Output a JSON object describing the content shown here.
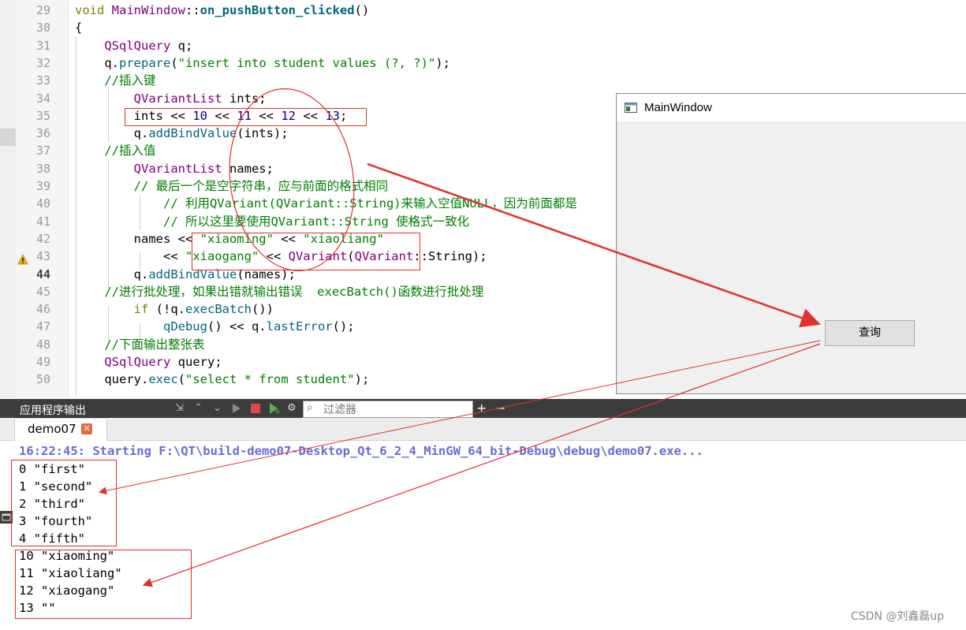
{
  "editor": {
    "line_numbers": [
      "29",
      "30",
      "31",
      "32",
      "33",
      "34",
      "35",
      "36",
      "37",
      "38",
      "39",
      "40",
      "41",
      "42",
      "43",
      "44",
      "45",
      "46",
      "47",
      "48",
      "49",
      "50"
    ],
    "current_line": "44",
    "lines": [
      [
        {
          "t": "void ",
          "c": "kw"
        },
        {
          "t": "MainWindow",
          "c": "typ"
        },
        {
          "t": "::",
          "c": ""
        },
        {
          "t": "on_pushButton_clicked",
          "c": "fn-b"
        },
        {
          "t": "()",
          "c": ""
        }
      ],
      [
        {
          "t": "{",
          "c": ""
        }
      ],
      [
        {
          "t": "    QSqlQuery ",
          "c": "typ"
        },
        {
          "t": "q;",
          "c": ""
        }
      ],
      [
        {
          "t": "    q.",
          "c": ""
        },
        {
          "t": "prepare",
          "c": "fn"
        },
        {
          "t": "(",
          "c": ""
        },
        {
          "t": "\"insert into student values (?, ?)\"",
          "c": "str"
        },
        {
          "t": ");",
          "c": ""
        }
      ],
      [
        {
          "t": "    //插入键",
          "c": "cm"
        }
      ],
      [
        {
          "t": "        QVariantList ",
          "c": "typ"
        },
        {
          "t": "ints;",
          "c": ""
        }
      ],
      [
        {
          "t": "        ints << ",
          "c": ""
        },
        {
          "t": "10",
          "c": "num"
        },
        {
          "t": " << ",
          "c": ""
        },
        {
          "t": "11",
          "c": "num"
        },
        {
          "t": " << ",
          "c": ""
        },
        {
          "t": "12",
          "c": "num"
        },
        {
          "t": " << ",
          "c": ""
        },
        {
          "t": "13",
          "c": "num"
        },
        {
          "t": ";",
          "c": ""
        }
      ],
      [
        {
          "t": "        q.",
          "c": ""
        },
        {
          "t": "addBindValue",
          "c": "fn"
        },
        {
          "t": "(ints);",
          "c": ""
        }
      ],
      [
        {
          "t": "    //插入值",
          "c": "cm"
        }
      ],
      [
        {
          "t": "        QVariantList ",
          "c": "typ"
        },
        {
          "t": "names;",
          "c": ""
        }
      ],
      [
        {
          "t": "        // 最后一个是空字符串，应与前面的格式相同",
          "c": "cm"
        }
      ],
      [
        {
          "t": "            // 利用QVariant(QVariant::String)来输入空值NULL，因为前面都是",
          "c": "cm"
        }
      ],
      [
        {
          "t": "            // 所以这里要使用QVariant::String 使格式一致化",
          "c": "cm"
        }
      ],
      [
        {
          "t": "        names << ",
          "c": ""
        },
        {
          "t": "\"xiaoming\"",
          "c": "str"
        },
        {
          "t": " << ",
          "c": ""
        },
        {
          "t": "\"xiaoliang\"",
          "c": "str"
        }
      ],
      [
        {
          "t": "            << ",
          "c": ""
        },
        {
          "t": "\"xiaogang\"",
          "c": "str"
        },
        {
          "t": " << ",
          "c": ""
        },
        {
          "t": "QVariant",
          "c": "typ"
        },
        {
          "t": "(",
          "c": ""
        },
        {
          "t": "QVariant",
          "c": "typ"
        },
        {
          "t": "::String);",
          "c": ""
        }
      ],
      [
        {
          "t": "        q.",
          "c": ""
        },
        {
          "t": "addBindValue",
          "c": "fn"
        },
        {
          "t": "(names);",
          "c": ""
        }
      ],
      [
        {
          "t": "    //进行批处理，如果出错就输出错误  execBatch()函数进行批处理",
          "c": "cm"
        }
      ],
      [
        {
          "t": "        ",
          "c": ""
        },
        {
          "t": "if",
          "c": "kw"
        },
        {
          "t": " (!q.",
          "c": ""
        },
        {
          "t": "execBatch",
          "c": "fn"
        },
        {
          "t": "())",
          "c": ""
        }
      ],
      [
        {
          "t": "            ",
          "c": ""
        },
        {
          "t": "qDebug",
          "c": "fn"
        },
        {
          "t": "() << q.",
          "c": ""
        },
        {
          "t": "lastError",
          "c": "fn"
        },
        {
          "t": "();",
          "c": ""
        }
      ],
      [
        {
          "t": "    //下面输出整张表",
          "c": "cm"
        }
      ],
      [
        {
          "t": "    QSqlQuery ",
          "c": "typ"
        },
        {
          "t": "query;",
          "c": ""
        }
      ],
      [
        {
          "t": "    query.",
          "c": ""
        },
        {
          "t": "exec",
          "c": "fn"
        },
        {
          "t": "(",
          "c": ""
        },
        {
          "t": "\"select * from student\"",
          "c": "str"
        },
        {
          "t": ");",
          "c": ""
        }
      ]
    ]
  },
  "mainwindow": {
    "title": "MainWindow",
    "query_button": "查询"
  },
  "output": {
    "pane_title": "应用程序输出",
    "filter_placeholder": "过滤器",
    "tab_label": "demo07",
    "start_line": "16:22:45: Starting F:\\QT\\build-demo07-Desktop_Qt_6_2_4_MinGW_64_bit-Debug\\debug\\demo07.exe...",
    "rows": [
      "0 \"first\"",
      "1 \"second\"",
      "2 \"third\"",
      "3 \"fourth\"",
      "4 \"fifth\"",
      "10 \"xiaoming\"",
      "11 \"xiaoliang\"",
      "12 \"xiaogang\"",
      "13 \"\""
    ]
  },
  "watermark": "CSDN @刘鑫磊up",
  "colors": {
    "annotation_red": "#e03030",
    "keyword": "#808000",
    "type": "#800080",
    "string": "#008000",
    "function": "#00677c"
  }
}
